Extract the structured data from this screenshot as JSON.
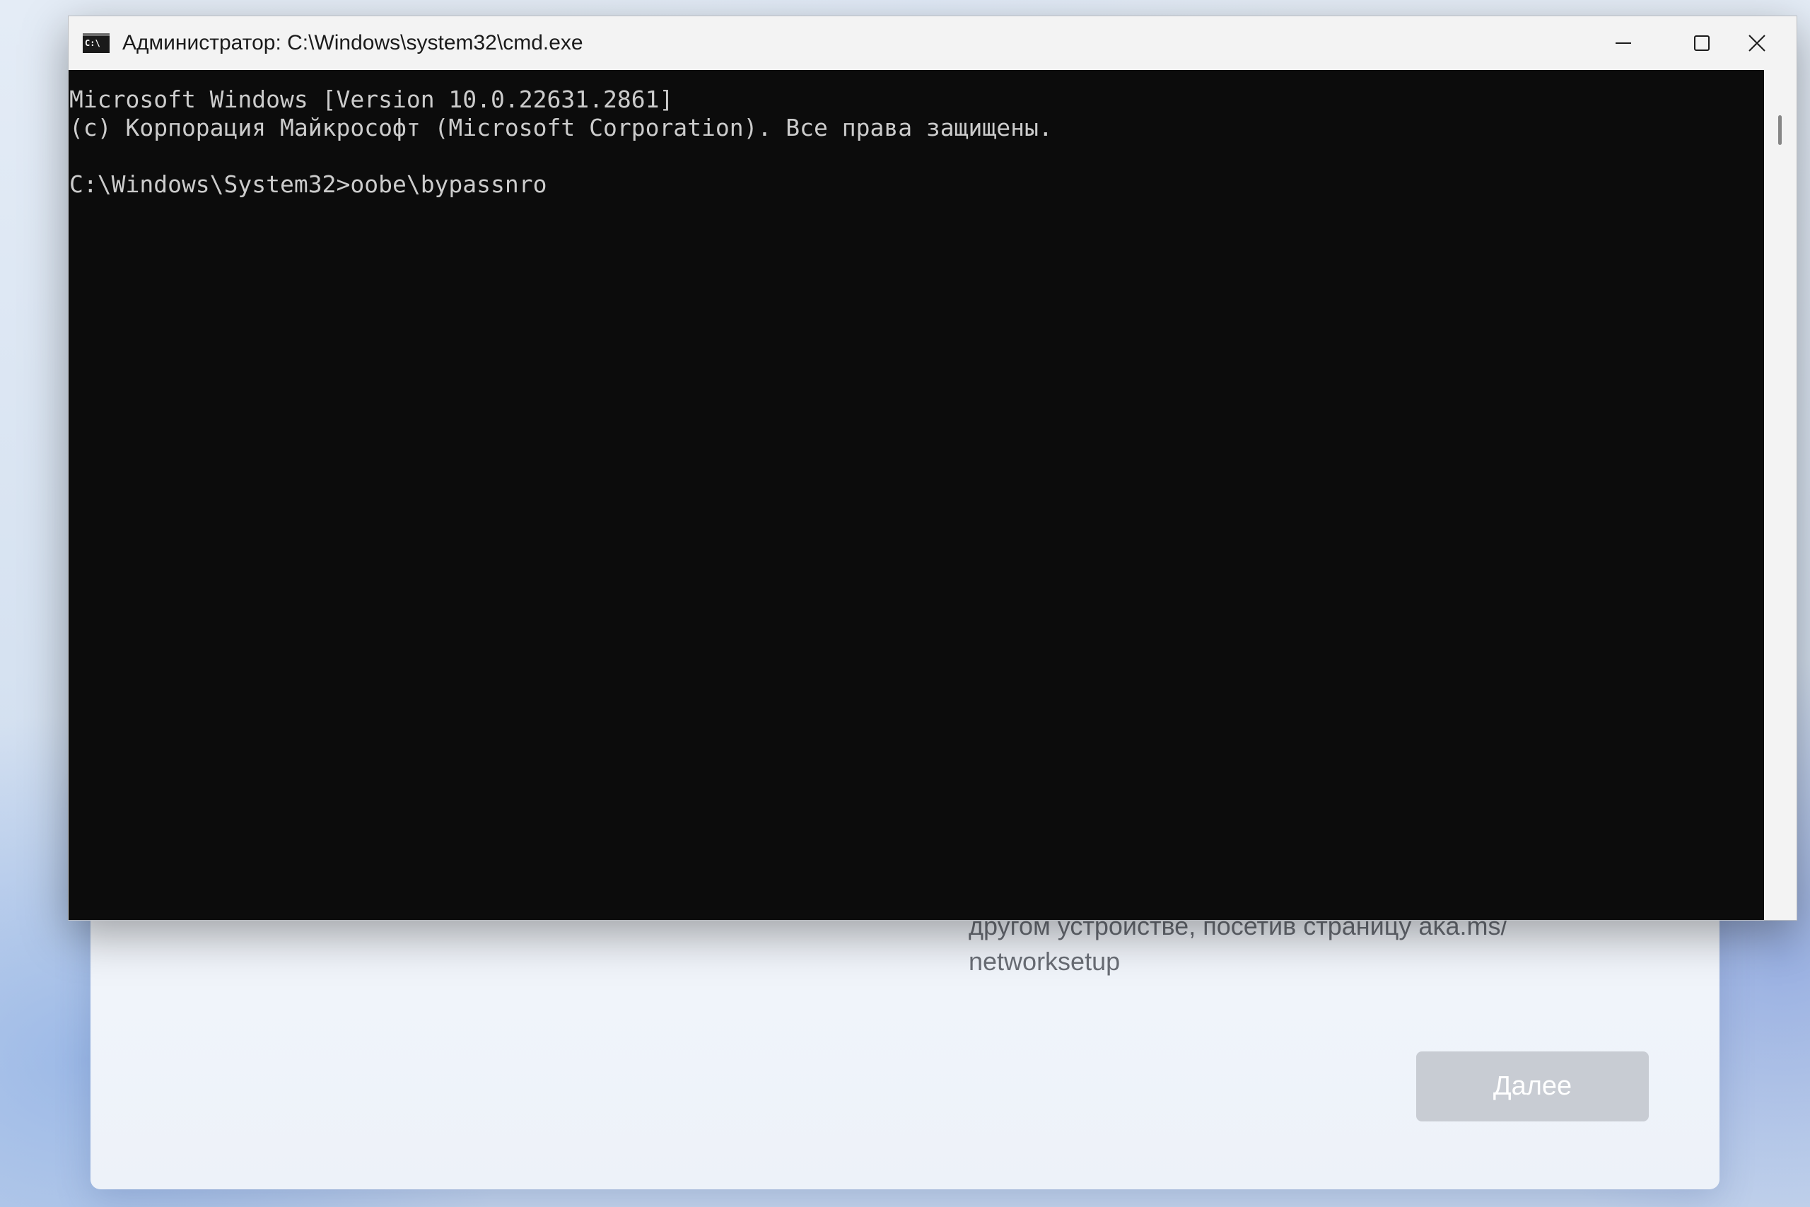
{
  "background_setup": {
    "body_text_lines": [
      "другом устройстве, посетив страницу aka.ms/",
      "networksetup"
    ],
    "next_button_label": "Далее",
    "next_button_color": "#c8ccd3"
  },
  "console": {
    "window_title": "Администратор: C:\\Windows\\system32\\cmd.exe",
    "app_icon": "cmd-icon",
    "app_icon_glyph": "C:\\",
    "caption_buttons": {
      "minimize": "minimize-icon",
      "maximize": "maximize-icon",
      "close": "close-icon"
    },
    "background_color": "#0c0c0c",
    "text_color": "#cccccc",
    "lines": [
      "Microsoft Windows [Version 10.0.22631.2861]",
      "(c) Корпорация Майкрософт (Microsoft Corporation). Все права защищены.",
      "",
      "C:\\Windows\\System32>oobe\\bypassnro"
    ]
  }
}
